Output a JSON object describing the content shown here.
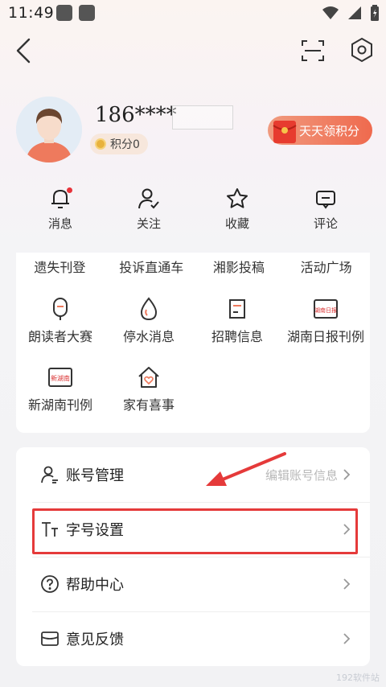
{
  "status_bar": {
    "time": "11:49"
  },
  "profile": {
    "username": "186****",
    "points_label": "积分0",
    "daily_button": "天天领积分"
  },
  "quick_actions": [
    {
      "label": "消息",
      "icon": "bell-icon",
      "badge": true
    },
    {
      "label": "关注",
      "icon": "follow-user-icon"
    },
    {
      "label": "收藏",
      "icon": "star-icon"
    },
    {
      "label": "评论",
      "icon": "comment-icon"
    }
  ],
  "services": {
    "top_row": [
      "遗失刊登",
      "投诉直通车",
      "湘影投稿",
      "活动广场"
    ],
    "grid": [
      {
        "label": "朗读者大赛",
        "icon": "microphone-icon"
      },
      {
        "label": "停水消息",
        "icon": "water-drop-icon"
      },
      {
        "label": "招聘信息",
        "icon": "recruit-icon"
      },
      {
        "label": "湖南日报刊例",
        "icon": "hunan-daily-logo-icon",
        "logo_text": "湖南日报"
      },
      {
        "label": "新湖南刊例",
        "icon": "new-hunan-logo-icon",
        "logo_text": "新湖南"
      },
      {
        "label": "家有喜事",
        "icon": "home-heart-icon"
      }
    ]
  },
  "settings": [
    {
      "label": "账号管理",
      "hint": "编辑账号信息",
      "icon": "account-icon"
    },
    {
      "label": "字号设置",
      "hint": "",
      "icon": "font-size-icon"
    },
    {
      "label": "帮助中心",
      "hint": "",
      "icon": "help-icon"
    },
    {
      "label": "意见反馈",
      "hint": "",
      "icon": "feedback-icon"
    }
  ],
  "watermark": "192软件站",
  "colors": {
    "accent": "#ef6a4e",
    "annotation": "#e53a3a"
  }
}
